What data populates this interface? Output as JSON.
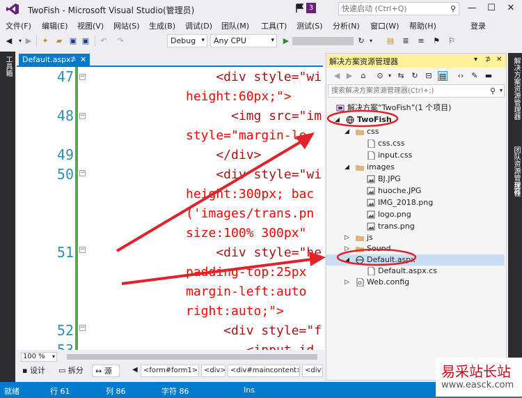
{
  "window": {
    "title": "TwoFish - Microsoft Visual Studio(管理员)",
    "notification_count": "3",
    "quick_launch_placeholder": "快速启动 (Ctrl+Q)",
    "minimize": "—",
    "maximize": "☐",
    "close": "✕"
  },
  "menu": {
    "items": [
      "文件(F)",
      "编辑(E)",
      "视图(V)",
      "网站(S)",
      "生成(B)",
      "调试(D)",
      "团队(M)",
      "工具(T)",
      "测试(S)",
      "分析(N)",
      "窗口(W)",
      "帮助(H)"
    ],
    "login": "登录"
  },
  "toolbar": {
    "config": "Debug",
    "platform": "Any CPU"
  },
  "left_strip": {
    "label": "工具箱"
  },
  "editor": {
    "tab_label": "Default.aspx",
    "tab_pin": "⊅",
    "tab_close": "✕",
    "lines": [
      {
        "num": "47",
        "text": "    <div style=\"wi"
      },
      {
        "num": "",
        "text": "height:60px;\">"
      },
      {
        "num": "48",
        "text": "      <img src=\"im"
      },
      {
        "num": "",
        "text": "style=\"margin-le"
      },
      {
        "num": "49",
        "text": "    </div>"
      },
      {
        "num": "50",
        "text": "    <div style=\"wi"
      },
      {
        "num": "",
        "text": "height:300px; bac"
      },
      {
        "num": "",
        "text": "('images/trans.pn"
      },
      {
        "num": "",
        "text": "size:100% 300px\""
      },
      {
        "num": "51",
        "text": "    <div style=\"he"
      },
      {
        "num": "",
        "text": "padding-top:25px"
      },
      {
        "num": "",
        "text": "margin-left:auto"
      },
      {
        "num": "",
        "text": "right:auto;\">"
      },
      {
        "num": "52",
        "text": "     <div style=\"f"
      },
      {
        "num": "53",
        "text": "        <input id"
      }
    ],
    "zoom": "100 %",
    "view_tabs": [
      "设计",
      "拆分",
      "源"
    ],
    "breadcrumbs": [
      "<form#form1>",
      "<div>",
      "<div#maincontent>",
      "<div>"
    ]
  },
  "solution_explorer": {
    "title": "解决方案资源管理器",
    "search_placeholder": "搜索解决方案资源管理器(Ctrl+;)",
    "tree": [
      {
        "label": "解决方案“TwoFish”(1 个项目)",
        "icon": "solution-icon",
        "expander": "",
        "bold": false
      },
      {
        "label": "TwoFish",
        "icon": "web-project-icon",
        "expander": "◢",
        "bold": true
      },
      {
        "label": "css",
        "icon": "folder-icon",
        "expander": "◢",
        "bold": false
      },
      {
        "label": "css.css",
        "icon": "file-icon",
        "expander": "",
        "bold": false
      },
      {
        "label": "input.css",
        "icon": "file-icon",
        "expander": "",
        "bold": false
      },
      {
        "label": "images",
        "icon": "folder-icon",
        "expander": "◢",
        "bold": false
      },
      {
        "label": "BJ.JPG",
        "icon": "image-file-icon",
        "expander": "",
        "bold": false
      },
      {
        "label": "huoche.JPG",
        "icon": "image-file-icon",
        "expander": "",
        "bold": false
      },
      {
        "label": "IMG_2018.png",
        "icon": "image-file-icon",
        "expander": "",
        "bold": false
      },
      {
        "label": "logo.png",
        "icon": "image-file-icon",
        "expander": "",
        "bold": false
      },
      {
        "label": "trans.png",
        "icon": "image-file-icon",
        "expander": "",
        "bold": false
      },
      {
        "label": "js",
        "icon": "folder-icon",
        "expander": "▷",
        "bold": false
      },
      {
        "label": "Sound",
        "icon": "folder-icon",
        "expander": "▷",
        "bold": false
      },
      {
        "label": "Default.aspx",
        "icon": "aspx-file-icon",
        "expander": "◢",
        "bold": false
      },
      {
        "label": "Default.aspx.cs",
        "icon": "cs-file-icon",
        "expander": "",
        "bold": false
      },
      {
        "label": "Web.config",
        "icon": "config-file-icon",
        "expander": "▷",
        "bold": false
      }
    ]
  },
  "right_strip": {
    "labels": [
      "解决方案资源管理器",
      "团队资源管理器",
      "属性"
    ]
  },
  "statusbar": {
    "ready": "就绪",
    "line": "行 61",
    "col": "列 86",
    "char": "字符 86",
    "mode": "Ins"
  },
  "watermark": {
    "cn": "易采站长站",
    "url": "www.easck.com"
  },
  "colors": {
    "accent": "#007ACC",
    "annotation": "#E0222A",
    "se_header": "#FFF29D"
  }
}
